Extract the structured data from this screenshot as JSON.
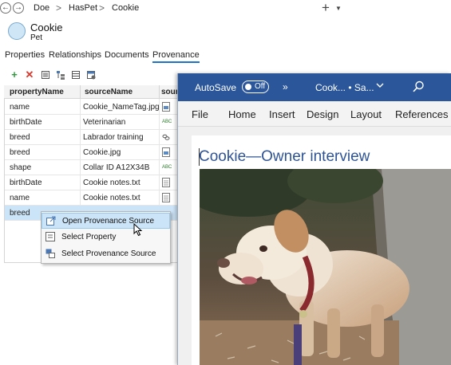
{
  "breadcrumb": {
    "items": [
      "Doe",
      "HasPet",
      "Cookie"
    ],
    "separator": ">"
  },
  "header": {
    "title": "Cookie",
    "subtitle": "Pet"
  },
  "tabs": [
    {
      "label": "Properties",
      "active": false
    },
    {
      "label": "Relationships",
      "active": false
    },
    {
      "label": "Documents",
      "active": false
    },
    {
      "label": "Provenance",
      "active": true
    }
  ],
  "table": {
    "columns": [
      "propertyName",
      "sourceName",
      "sour"
    ],
    "rows": [
      {
        "property": "name",
        "source": "Cookie_NameTag.jpg",
        "icon": "image-file-icon"
      },
      {
        "property": "birthDate",
        "source": "Veterinarian",
        "icon": "abc-icon"
      },
      {
        "property": "breed",
        "source": "Labrador training",
        "icon": "link-icon"
      },
      {
        "property": "breed",
        "source": "Cookie.jpg",
        "icon": "image-file-icon"
      },
      {
        "property": "shape",
        "source": "Collar ID A12X34B",
        "icon": "abc-icon"
      },
      {
        "property": "birthDate",
        "source": "Cookie notes.txt",
        "icon": "text-file-icon"
      },
      {
        "property": "name",
        "source": "Cookie notes.txt",
        "icon": "text-file-icon"
      },
      {
        "property": "breed",
        "source": "",
        "icon": ""
      }
    ]
  },
  "context_menu": {
    "items": [
      {
        "label": "Open Provenance Source",
        "hot": true
      },
      {
        "label": "Select Property",
        "hot": false
      },
      {
        "label": "Select Provenance Source",
        "hot": false
      }
    ]
  },
  "word": {
    "autosave_label": "AutoSave",
    "autosave_state": "Off",
    "more": "»",
    "doc_name": "Cook... • Sa...",
    "ribbon_tabs": [
      "File",
      "Home",
      "Insert",
      "Design",
      "Layout",
      "References"
    ],
    "heading": "Cookie—Owner interview"
  },
  "colors": {
    "accent": "#1f72c4",
    "word_blue": "#2b579a",
    "selection": "#cce4f7",
    "heading": "#2f5496"
  }
}
